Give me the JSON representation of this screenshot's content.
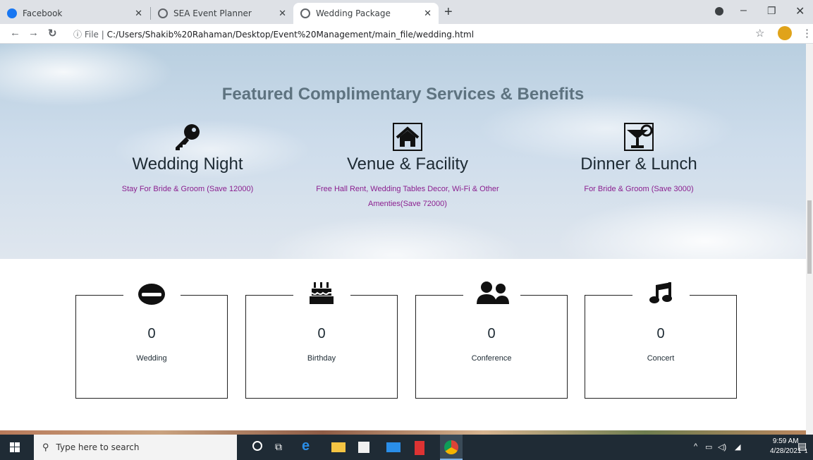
{
  "browser": {
    "tabs": [
      {
        "title": "Facebook",
        "favicon_color": "#1877f2",
        "active": false
      },
      {
        "title": "SEA Event Planner",
        "favicon_color": "#5f6368",
        "active": false
      },
      {
        "title": "Wedding Package",
        "favicon_color": "#5f6368",
        "active": true
      }
    ],
    "new_tab_icon": "+",
    "url_prefix": "File",
    "url": "C:/Users/Shakib%20Rahaman/Desktop/Event%20Management/main_file/wedding.html"
  },
  "page": {
    "hero_title": "Featured Complimentary Services & Benefits",
    "services": [
      {
        "icon": "key-icon",
        "title": "Wedding Night",
        "description": "Stay For Bride & Groom (Save 12000)"
      },
      {
        "icon": "home-icon",
        "title": "Venue & Facility",
        "description": "Free Hall Rent, Wedding Tables Decor, Wi-Fi & Other Amenties(Save 72000)"
      },
      {
        "icon": "cocktail-icon",
        "title": "Dinner & Lunch",
        "description": "For Bride & Groom (Save 3000)"
      }
    ],
    "counters": [
      {
        "icon": "ring-icon",
        "value": "0",
        "label": "Wedding"
      },
      {
        "icon": "birthday-cake-icon",
        "value": "0",
        "label": "Birthday"
      },
      {
        "icon": "users-icon",
        "value": "0",
        "label": "Conference"
      },
      {
        "icon": "music-icon",
        "value": "0",
        "label": "Concert"
      }
    ],
    "text_color": "#1d2a33",
    "accent_color": "#8b1f8f"
  },
  "taskbar": {
    "search_placeholder": "Type here to search",
    "time": "9:59 AM",
    "date": "4/28/2021",
    "notification_count": "1"
  }
}
